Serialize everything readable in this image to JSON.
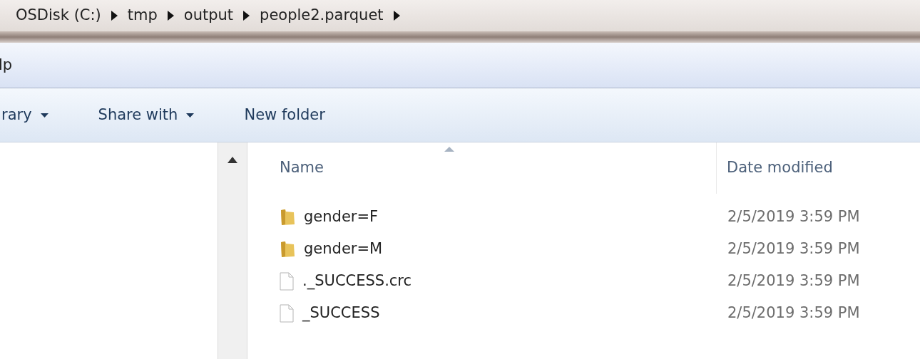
{
  "breadcrumb": [
    "OSDisk (C:)",
    "tmp",
    "output",
    "people2.parquet"
  ],
  "menu_bar": {
    "items": [
      "lp"
    ]
  },
  "toolbar": {
    "items": [
      {
        "label": "rary",
        "dropdown": true
      },
      {
        "label": "Share with",
        "dropdown": true
      },
      {
        "label": "New folder",
        "dropdown": false
      }
    ]
  },
  "file_list": {
    "columns": [
      {
        "label": "Name",
        "sorted": true
      },
      {
        "label": "Date modified",
        "sorted": false
      }
    ],
    "rows": [
      {
        "name": "gender=F",
        "kind": "folder",
        "date_modified": "2/5/2019 3:59 PM"
      },
      {
        "name": "gender=M",
        "kind": "folder",
        "date_modified": "2/5/2019 3:59 PM"
      },
      {
        "name": "._SUCCESS.crc",
        "kind": "file",
        "date_modified": "2/5/2019 3:59 PM"
      },
      {
        "name": "_SUCCESS",
        "kind": "file",
        "date_modified": "2/5/2019 3:59 PM"
      }
    ]
  }
}
